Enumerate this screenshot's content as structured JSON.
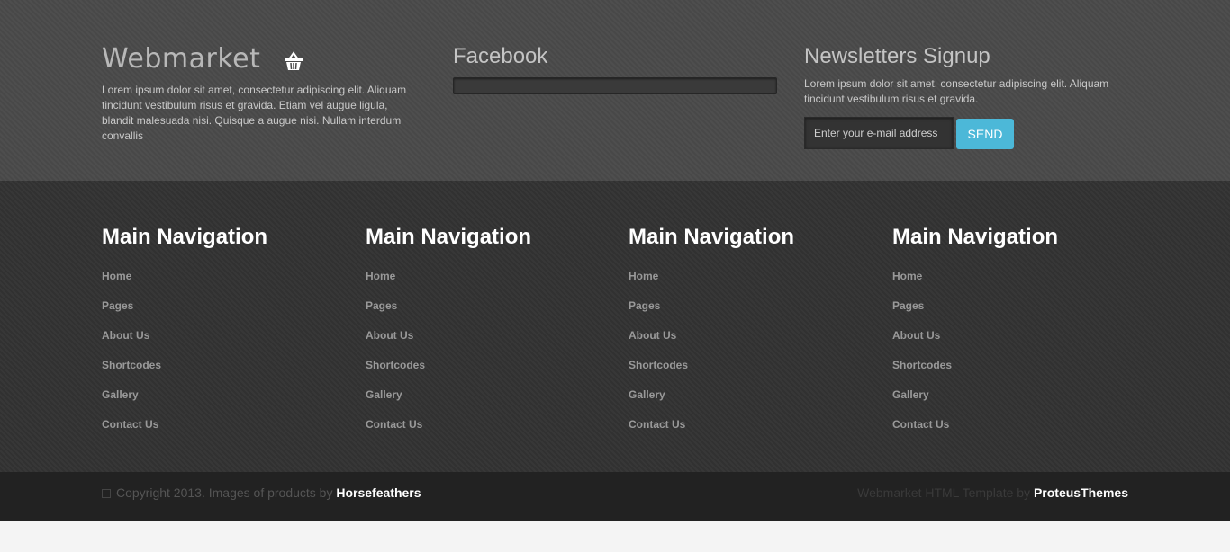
{
  "brand": {
    "name": "Webmarket"
  },
  "about": {
    "text": "Lorem ipsum dolor sit amet, consectetur adipiscing elit. Aliquam tincidunt vestibulum risus et gravida. Etiam vel augue ligula, blandit malesuada nisi. Quisque a augue nisi. Nullam interdum convallis"
  },
  "facebook": {
    "title": "Facebook"
  },
  "newsletter": {
    "title": "Newsletters Signup",
    "text": "Lorem ipsum dolor sit amet, consectetur adipiscing elit. Aliquam tincidunt vestibulum risus et gravida.",
    "placeholder": "Enter your e-mail address",
    "send_label": "SEND"
  },
  "nav_columns": [
    {
      "title": "Main Navigation",
      "items": [
        "Home",
        "Pages",
        "About Us",
        "Shortcodes",
        "Gallery",
        "Contact Us"
      ]
    },
    {
      "title": "Main Navigation",
      "items": [
        "Home",
        "Pages",
        "About Us",
        "Shortcodes",
        "Gallery",
        "Contact Us"
      ]
    },
    {
      "title": "Main Navigation",
      "items": [
        "Home",
        "Pages",
        "About Us",
        "Shortcodes",
        "Gallery",
        "Contact Us"
      ]
    },
    {
      "title": "Main Navigation",
      "items": [
        "Home",
        "Pages",
        "About Us",
        "Shortcodes",
        "Gallery",
        "Contact Us"
      ]
    }
  ],
  "footer": {
    "copyright": "Copyright 2013. Images of products by",
    "copyright_link": "Horsefeathers",
    "credit": "Webmarket HTML Template by",
    "credit_link": "ProteusThemes"
  },
  "colors": {
    "accent": "#4cb8d8",
    "top_bg": "#4a4a4a",
    "mid_bg": "#333333",
    "bottom_bg": "#222222"
  }
}
